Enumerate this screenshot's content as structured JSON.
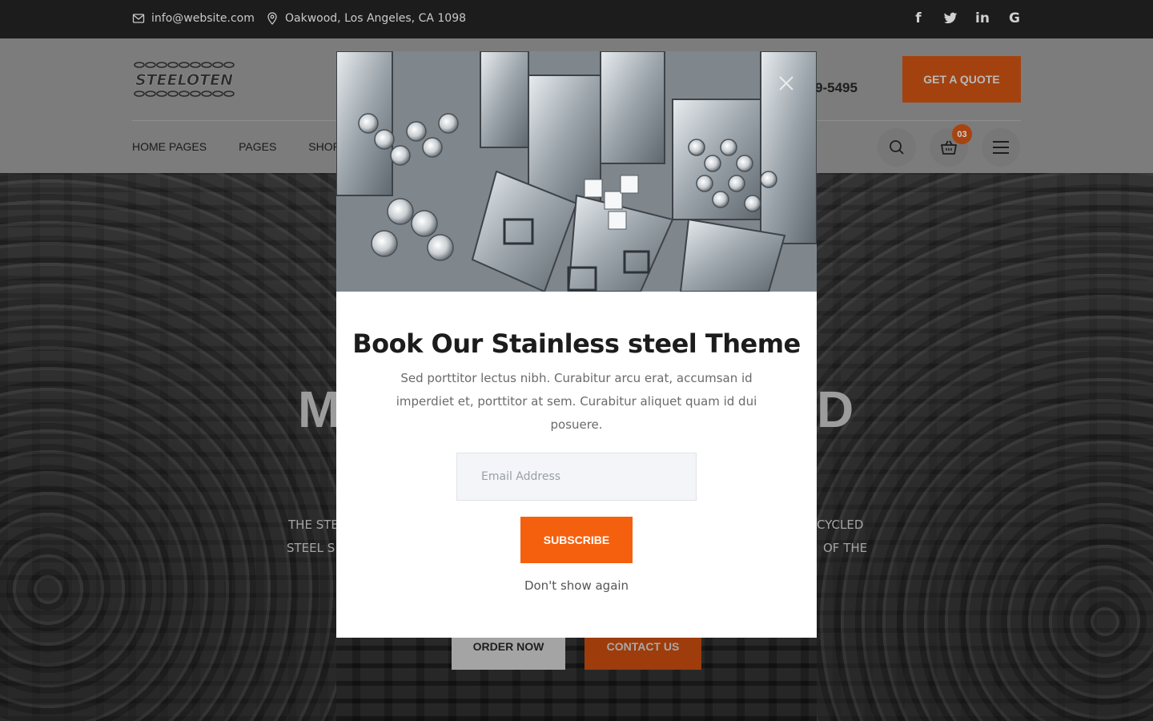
{
  "topbar": {
    "email": "info@website.com",
    "address": "Oakwood, Los Angeles, CA 1098",
    "social": [
      {
        "icon": "facebook-icon",
        "glyph": "f"
      },
      {
        "icon": "twitter-icon",
        "glyph": "t"
      },
      {
        "icon": "linkedin-icon",
        "glyph": "in"
      },
      {
        "icon": "google-icon",
        "glyph": "G"
      }
    ]
  },
  "header": {
    "logo_text": "STEELOTEN",
    "phone_partial": "9-5495",
    "quote_label": "GET A QUOTE",
    "nav": [
      "HOME PAGES",
      "PAGES",
      "SHOP"
    ],
    "cart_count": "03"
  },
  "hero": {
    "title_left": "M",
    "title_right": "D",
    "sub_line1_left": "THE STE",
    "sub_line1_right": "CYCLED",
    "sub_line2_left": "STEEL S",
    "sub_line2_right": "OF THE",
    "order_label": "ORDER NOW",
    "contact_label": "CONTACT US"
  },
  "modal": {
    "title": "Book Our Stainless steel Theme",
    "text": "Sed porttitor lectus nibh. Curabitur arcu erat, accumsan id imperdiet et, porttitor at sem. Curabitur aliquet quam id dui posuere.",
    "email_placeholder": "Email Address",
    "subscribe_label": "SUBSCRIBE",
    "dont_show_label": "Don't show again"
  },
  "colors": {
    "accent": "#f5600f",
    "topbar": "#1c1c1c",
    "overlay_dim": "#7c7c7c"
  }
}
